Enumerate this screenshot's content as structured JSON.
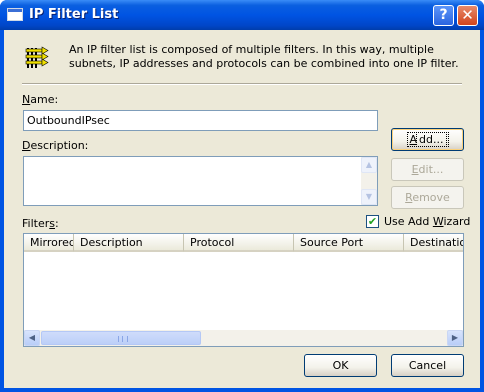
{
  "window": {
    "title": "IP Filter List"
  },
  "info": {
    "text": "An IP filter list is composed of multiple filters. In this way, multiple subnets, IP addresses and protocols can be combined into one IP filter."
  },
  "name": {
    "label_u": "N",
    "label_rest": "ame:",
    "value": "OutboundIPsec"
  },
  "description": {
    "label_u": "D",
    "label_rest": "escription:",
    "value": ""
  },
  "buttons": {
    "add_u": "A",
    "add_rest": "dd...",
    "edit_u": "E",
    "edit_rest": "dit...",
    "remove_u": "R",
    "remove_rest": "emove",
    "ok": "OK",
    "cancel": "Cancel"
  },
  "filters": {
    "label_pre": "Filter",
    "label_u": "s",
    "label_post": ":",
    "columns": [
      "Mirrored",
      "Description",
      "Protocol",
      "Source Port",
      "Destination"
    ],
    "rows": []
  },
  "use_add_wizard": {
    "label_pre": "Use Add ",
    "label_u": "W",
    "label_post": "izard",
    "checked": true
  },
  "icons": [
    "filter-list-icon",
    "help-icon",
    "close-icon",
    "window-icon"
  ]
}
